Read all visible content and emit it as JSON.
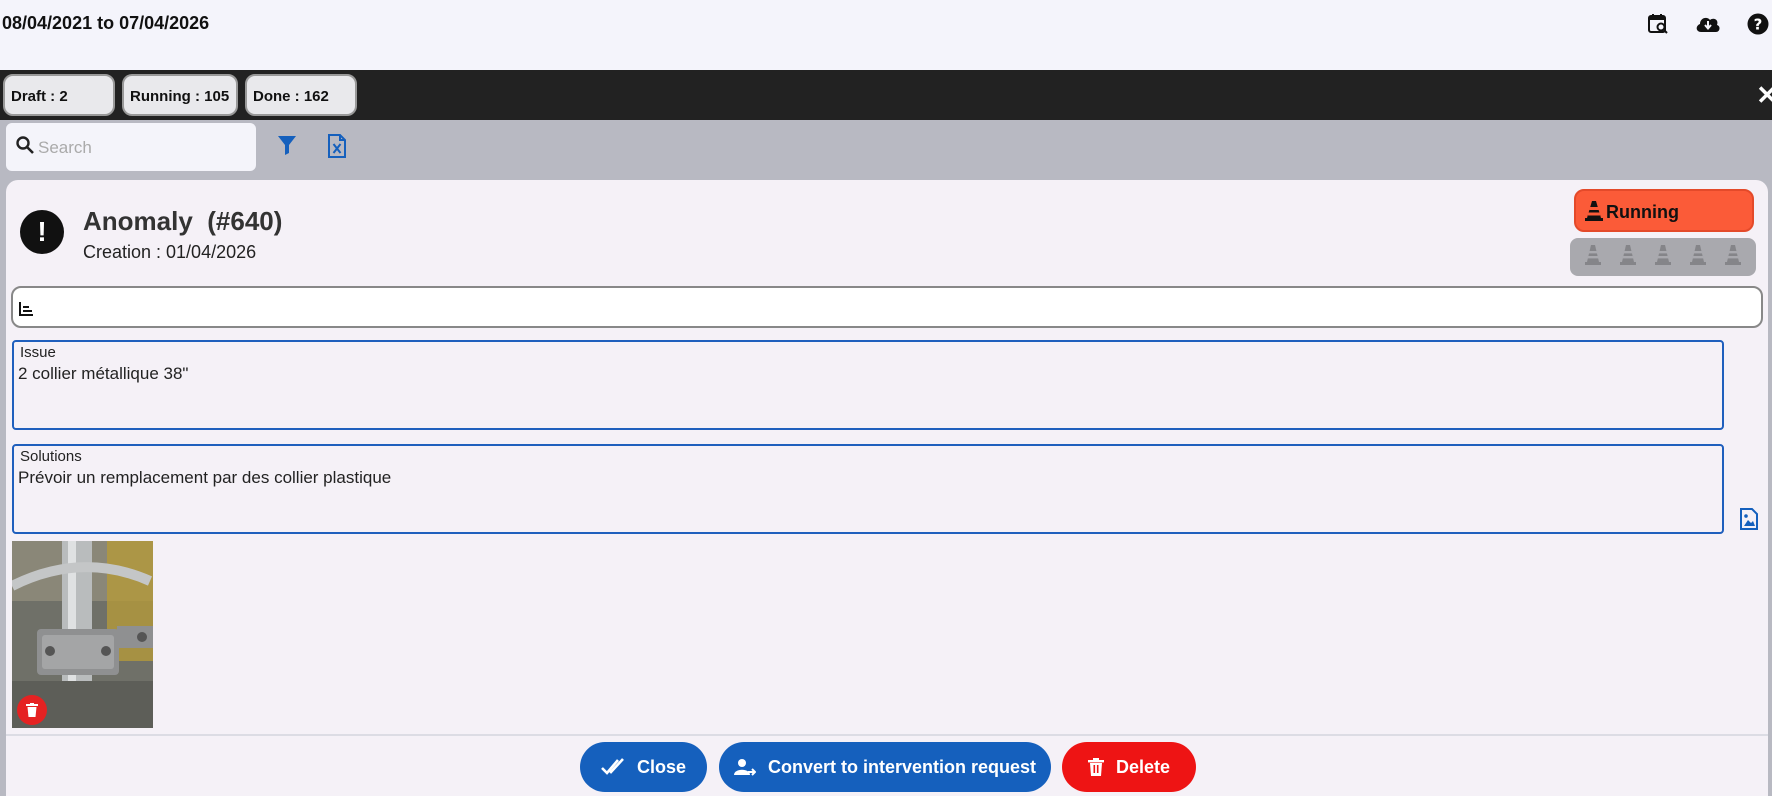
{
  "header": {
    "date_range": "08/04/2021 to 07/04/2026",
    "icons": [
      "calendar-search-icon",
      "cloud-download-icon",
      "help-icon"
    ]
  },
  "status_tabs": [
    {
      "label": "Draft : 2"
    },
    {
      "label": "Running : 105"
    },
    {
      "label": "Done : 162"
    }
  ],
  "toolbar": {
    "search_placeholder": "Search",
    "icons": [
      "filter-icon",
      "excel-export-icon"
    ]
  },
  "record": {
    "type": "Anomaly",
    "number": "(#640)",
    "creation": "Creation : 01/04/2026",
    "status_label": "Running",
    "status_color": "#fb5b38",
    "status_step_count": 5,
    "issue_label": "Issue",
    "issue_value": "2 collier métallique 38\"",
    "solutions_label": "Solutions",
    "solutions_value": "Prévoir un remplacement par des collier plastique"
  },
  "actions": {
    "close_label": "Close",
    "convert_label": "Convert to intervention request",
    "delete_label": "Delete"
  },
  "colors": {
    "accent_blue": "#1560bd",
    "danger_red": "#ee1414",
    "dark_bar": "#222222"
  }
}
